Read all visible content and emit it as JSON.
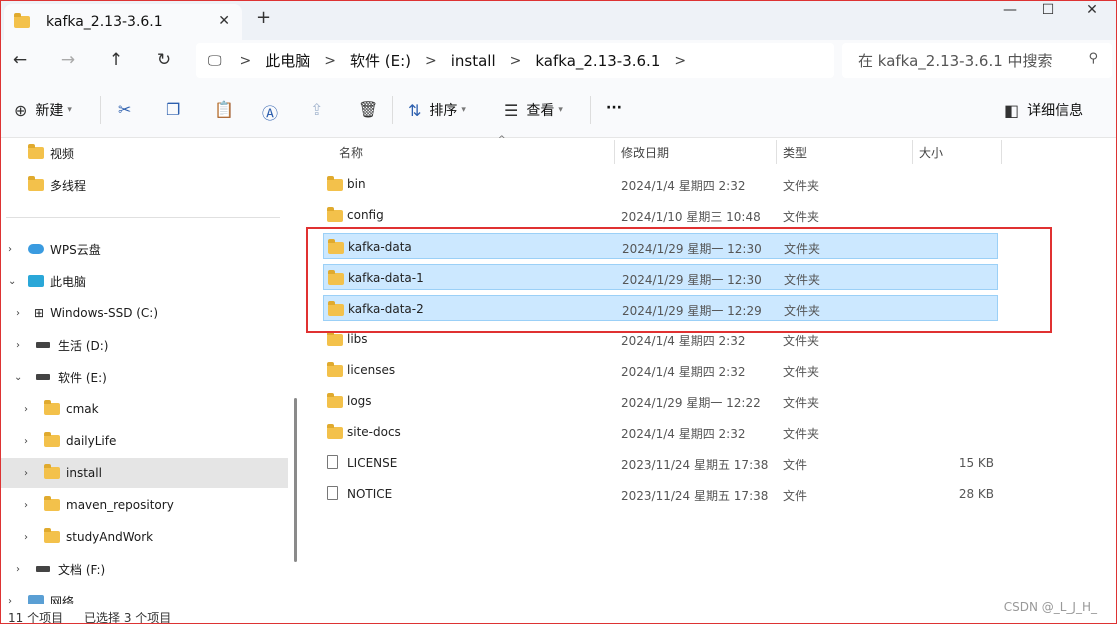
{
  "window": {
    "tab_title": "kafka_2.13-3.6.1",
    "tab_close": "✕",
    "new_tab": "+",
    "minimize": "—",
    "maximize": "☐",
    "close": "✕"
  },
  "nav": {
    "back": "←",
    "forward": "→",
    "up": "↑",
    "refresh": "↻",
    "pc_icon": "🖵",
    "breadcrumb": [
      "此电脑",
      "软件 (E:)",
      "install",
      "kafka_2.13-3.6.1"
    ],
    "sep": ">",
    "search_placeholder": "在 kafka_2.13-3.6.1 中搜索"
  },
  "toolbar": {
    "new_label": "新建",
    "sort_label": "排序",
    "view_label": "查看",
    "more_label": "···",
    "details_label": "详细信息"
  },
  "sidebar": {
    "items": [
      {
        "label": "视频",
        "icon": "folder-icon"
      },
      {
        "label": "多线程",
        "icon": "folder-icon"
      },
      {
        "label": "WPS云盘",
        "icon": "cloud-icon"
      },
      {
        "label": "此电脑",
        "icon": "pc-icon"
      },
      {
        "label": "Windows-SSD (C:)",
        "icon": "windows-icon"
      },
      {
        "label": "生活 (D:)",
        "icon": "drive-icon"
      },
      {
        "label": "软件 (E:)",
        "icon": "drive-icon"
      },
      {
        "label": "cmak",
        "icon": "folder-icon"
      },
      {
        "label": "dailyLife",
        "icon": "folder-icon"
      },
      {
        "label": "install",
        "icon": "folder-icon"
      },
      {
        "label": "maven_repository",
        "icon": "folder-icon"
      },
      {
        "label": "studyAndWork",
        "icon": "folder-icon"
      },
      {
        "label": "文档 (F:)",
        "icon": "drive-icon"
      },
      {
        "label": "网络",
        "icon": "network-icon"
      }
    ]
  },
  "columns": {
    "name": "名称",
    "modified": "修改日期",
    "type": "类型",
    "size": "大小"
  },
  "files": [
    {
      "name": "bin",
      "date": "2024/1/4  星期四 2:32",
      "type": "文件夹",
      "size": "",
      "kind": "folder",
      "selected": false
    },
    {
      "name": "config",
      "date": "2024/1/10  星期三 10:48",
      "type": "文件夹",
      "size": "",
      "kind": "folder",
      "selected": false
    },
    {
      "name": "kafka-data",
      "date": "2024/1/29  星期一 12:30",
      "type": "文件夹",
      "size": "",
      "kind": "folder",
      "selected": true
    },
    {
      "name": "kafka-data-1",
      "date": "2024/1/29  星期一 12:30",
      "type": "文件夹",
      "size": "",
      "kind": "folder",
      "selected": true
    },
    {
      "name": "kafka-data-2",
      "date": "2024/1/29  星期一 12:29",
      "type": "文件夹",
      "size": "",
      "kind": "folder",
      "selected": true
    },
    {
      "name": "libs",
      "date": "2024/1/4  星期四 2:32",
      "type": "文件夹",
      "size": "",
      "kind": "folder",
      "selected": false
    },
    {
      "name": "licenses",
      "date": "2024/1/4  星期四 2:32",
      "type": "文件夹",
      "size": "",
      "kind": "folder",
      "selected": false
    },
    {
      "name": "logs",
      "date": "2024/1/29  星期一 12:22",
      "type": "文件夹",
      "size": "",
      "kind": "folder",
      "selected": false
    },
    {
      "name": "site-docs",
      "date": "2024/1/4  星期四 2:32",
      "type": "文件夹",
      "size": "",
      "kind": "folder",
      "selected": false
    },
    {
      "name": "LICENSE",
      "date": "2023/11/24  星期五 17:38",
      "type": "文件",
      "size": "15 KB",
      "kind": "file",
      "selected": false
    },
    {
      "name": "NOTICE",
      "date": "2023/11/24  星期五 17:38",
      "type": "文件",
      "size": "28 KB",
      "kind": "file",
      "selected": false
    }
  ],
  "status": {
    "item_count": "11 个项目",
    "selected_count": "已选择 3 个项目"
  },
  "watermark": "CSDN @_L_J_H_",
  "colors": {
    "selection": "#cce8ff",
    "highlight_box": "#e03131",
    "accent": "#2d5fae"
  }
}
